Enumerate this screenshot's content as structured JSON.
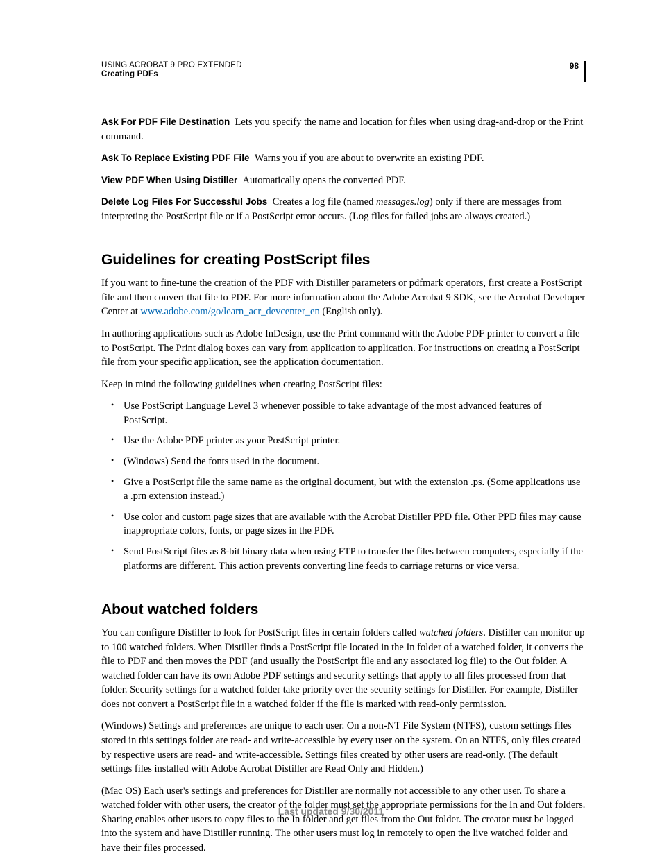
{
  "header": {
    "line1": "USING ACROBAT 9 PRO EXTENDED",
    "line2": "Creating PDFs",
    "page_number": "98"
  },
  "defs": {
    "d1_term": "Ask For PDF File Destination",
    "d1_body": "Lets you specify the name and location for files when using drag-and-drop or the Print command.",
    "d2_term": "Ask To Replace Existing PDF File",
    "d2_body": "Warns you if you are about to overwrite an existing PDF.",
    "d3_term": "View PDF When Using Distiller",
    "d3_body": "Automatically opens the converted PDF.",
    "d4_term": "Delete Log Files For Successful Jobs",
    "d4_a": "Creates a log file (named ",
    "d4_ital": "messages.log",
    "d4_b": ") only if there are messages from interpreting the PostScript file or if a PostScript error occurs. (Log files for failed jobs are always created.)"
  },
  "section1": {
    "title": "Guidelines for creating PostScript files",
    "p1_a": "If you want to fine-tune the creation of the PDF with Distiller parameters or pdfmark operators, first create a PostScript file and then convert that file to PDF. For more information about the Adobe Acrobat 9 SDK, see the Acrobat Developer Center at ",
    "p1_link": "www.adobe.com/go/learn_acr_devcenter_en",
    "p1_b": " (English only).",
    "p2": "In authoring applications such as Adobe InDesign, use the Print command with the Adobe PDF printer to convert a file to PostScript. The Print dialog boxes can vary from application to application. For instructions on creating a PostScript file from your specific application, see the application documentation.",
    "p3": "Keep in mind the following guidelines when creating PostScript files:",
    "bullets": {
      "b1": "Use PostScript Language Level 3 whenever possible to take advantage of the most advanced features of PostScript.",
      "b2": "Use the Adobe PDF printer as your PostScript printer.",
      "b3": "(Windows) Send the fonts used in the document.",
      "b4": "Give a PostScript file the same name as the original document, but with the extension .ps. (Some applications use a .prn extension instead.)",
      "b5": "Use color and custom page sizes that are available with the Acrobat Distiller PPD file. Other PPD files may cause inappropriate colors, fonts, or page sizes in the PDF.",
      "b6": "Send PostScript files as 8-bit binary data when using FTP to transfer the files between computers, especially if the platforms are different. This action prevents converting line feeds to carriage returns or vice versa."
    }
  },
  "section2": {
    "title": "About watched folders",
    "p1_a": "You can configure Distiller to look for PostScript files in certain folders called ",
    "p1_ital": "watched folders",
    "p1_b": ". Distiller can monitor up to 100 watched folders. When Distiller finds a PostScript file located in the In folder of a watched folder, it converts the file to PDF and then moves the PDF (and usually the PostScript file and any associated log file) to the Out folder. A watched folder can have its own Adobe PDF settings and security settings that apply to all files processed from that folder. Security settings for a watched folder take priority over the security settings for Distiller. For example, Distiller does not convert a PostScript file in a watched folder if the file is marked with read-only permission.",
    "p2": "(Windows) Settings and preferences are unique to each user. On a non-NT File System (NTFS), custom settings files stored in this settings folder are read- and write-accessible by every user on the system. On an NTFS, only files created by respective users are read- and write-accessible. Settings files created by other users are read-only. (The default settings files installed with Adobe Acrobat Distiller are Read Only and Hidden.)",
    "p3": "(Mac OS) Each user's settings and preferences for Distiller are normally not accessible to any other user. To share a watched folder with other users, the creator of the folder must set the appropriate permissions for the In and Out folders. Sharing enables other users to copy files to the In folder and get files from the Out folder. The creator must be logged into the system and have Distiller running. The other users must log in remotely to open the live watched folder and have their files processed."
  },
  "footer": {
    "updated": "Last updated 9/30/2011"
  }
}
